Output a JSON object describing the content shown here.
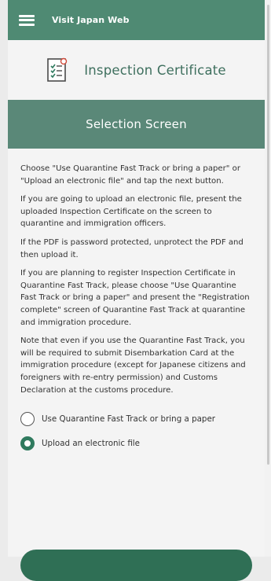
{
  "header": {
    "app_title": "Visit Japan Web"
  },
  "certificate": {
    "title": "Inspection Certificate"
  },
  "section": {
    "title": "Selection Screen"
  },
  "instructions": [
    "Choose \"Use Quarantine Fast Track or bring a paper\" or \"Upload an electronic file\" and tap the next button.",
    "If you are going to upload an electronic file, present the uploaded Inspection Certificate on the screen to quarantine and immigration officers.",
    "If the PDF is password protected, unprotect the PDF and then upload it.",
    "If you are planning to register Inspection Certificate in Quarantine Fast Track, please choose \"Use Quarantine Fast Track or bring a paper\" and present the \"Registration complete\" screen of Quarantine Fast Track at quarantine and immigration procedure.",
    "Note that even if you use the Quarantine Fast Track, you will be required to submit Disembarkation Card at the immigration procedure (except for Japanese citizens and foreigners with re-entry permission) and Customs Declaration at the customs procedure."
  ],
  "options": [
    {
      "label": "Use Quarantine Fast Track or bring a paper",
      "selected": false
    },
    {
      "label": "Upload an electronic file",
      "selected": true
    }
  ],
  "colors": {
    "header_green": "#4f8a73",
    "banner_green": "#5a8878",
    "title_green": "#3e6f5e",
    "radio_selected": "#2f7a5e"
  },
  "icons": {
    "menu": "hamburger-menu-icon",
    "certificate": "document-checklist-icon"
  }
}
